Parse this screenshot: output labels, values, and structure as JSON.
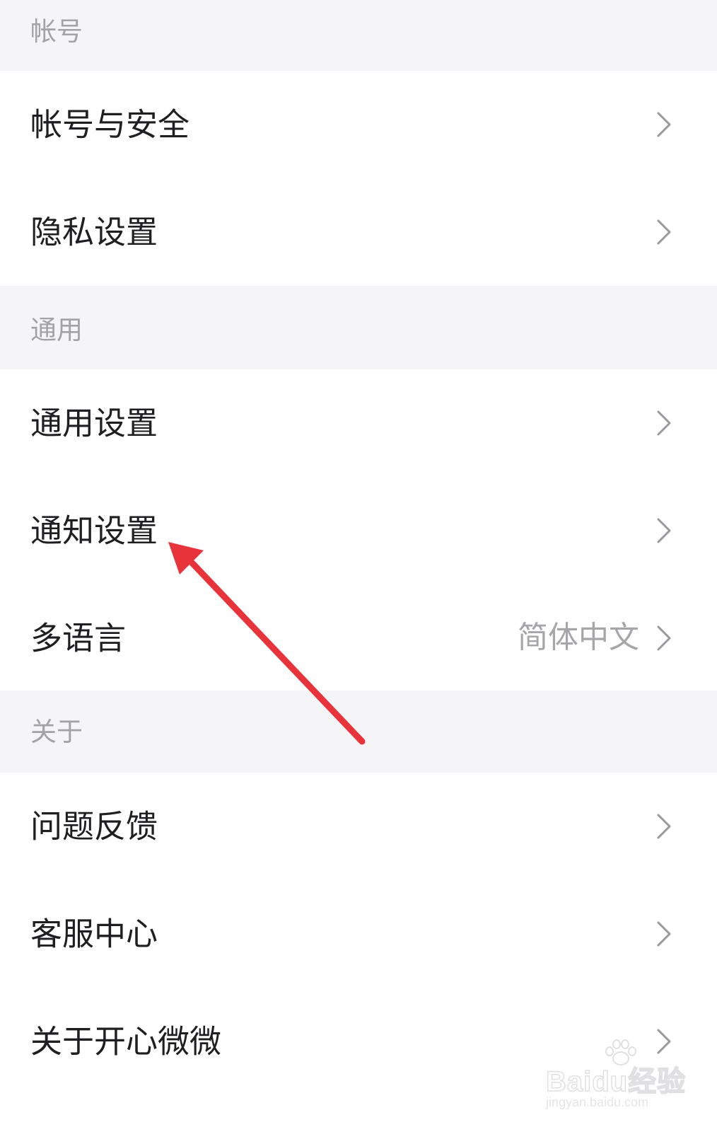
{
  "sections": [
    {
      "header": "帐号",
      "rows": [
        {
          "title": "帐号与安全"
        },
        {
          "title": "隐私设置"
        }
      ]
    },
    {
      "header": "通用",
      "rows": [
        {
          "title": "通用设置"
        },
        {
          "title": "通知设置"
        },
        {
          "title": "多语言",
          "value": "简体中文"
        }
      ]
    },
    {
      "header": "关于",
      "rows": [
        {
          "title": "问题反馈"
        },
        {
          "title": "客服中心"
        },
        {
          "title": "关于开心微微"
        }
      ]
    }
  ],
  "annotation": {
    "icon": "red-arrow-icon",
    "color": "#e8333a",
    "points_to": "通知设置"
  },
  "watermark": {
    "brand": "Baidu经验",
    "url": "jingyan.baidu.com"
  },
  "colors": {
    "section_bg": "#f5f5f7",
    "row_bg": "#ffffff",
    "title_text": "#1f1f21",
    "muted_text": "#a3a3a6"
  }
}
